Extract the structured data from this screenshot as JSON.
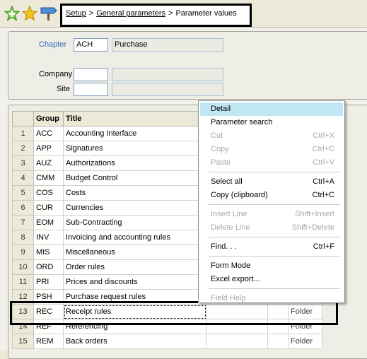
{
  "toolbar": {
    "icons": [
      "add-favorite-icon",
      "favorite-star-icon",
      "sign-icon"
    ]
  },
  "breadcrumb": {
    "items": [
      "Setup",
      "General parameters",
      "Parameter values"
    ],
    "separator": ">"
  },
  "header": {
    "chapter_label": "Chapter",
    "chapter_code": "ACH",
    "chapter_name": "Purchase",
    "company_label": "Company",
    "company_value": "",
    "company_name": "",
    "site_label": "Site",
    "site_value": "",
    "site_name": ""
  },
  "table": {
    "columns": [
      "Group",
      "Title"
    ],
    "rows": [
      {
        "num": "1",
        "group": "ACC",
        "title": "Accounting Interface",
        "extra": ""
      },
      {
        "num": "2",
        "group": "APP",
        "title": "Signatures",
        "extra": ""
      },
      {
        "num": "3",
        "group": "AUZ",
        "title": "Authorizations",
        "extra": ""
      },
      {
        "num": "4",
        "group": "CMM",
        "title": "Budget Control",
        "extra": ""
      },
      {
        "num": "5",
        "group": "COS",
        "title": "Costs",
        "extra": ""
      },
      {
        "num": "6",
        "group": "CUR",
        "title": "Currencies",
        "extra": ""
      },
      {
        "num": "7",
        "group": "EOM",
        "title": "Sub-Contracting",
        "extra": ""
      },
      {
        "num": "8",
        "group": "INV",
        "title": "Invoicing and accounting rules",
        "extra": ""
      },
      {
        "num": "9",
        "group": "MIS",
        "title": "Miscellaneous",
        "extra": ""
      },
      {
        "num": "10",
        "group": "ORD",
        "title": "Order rules",
        "extra": ""
      },
      {
        "num": "11",
        "group": "PRI",
        "title": "Prices and discounts",
        "extra": ""
      },
      {
        "num": "12",
        "group": "PSH",
        "title": "Purchase request rules",
        "extra": ""
      },
      {
        "num": "13",
        "group": "REC",
        "title": "Receipt rules",
        "extra": "Folder"
      },
      {
        "num": "14",
        "group": "REF",
        "title": "Referencing",
        "extra": "Folder"
      },
      {
        "num": "15",
        "group": "REM",
        "title": "Back orders",
        "extra": "Folder"
      }
    ]
  },
  "context_menu": {
    "items": [
      {
        "label": "Detail",
        "shortcut": "",
        "disabled": false,
        "highlighted": true
      },
      {
        "label": "Parameter search",
        "shortcut": "",
        "disabled": false
      },
      {
        "label": "Cut",
        "shortcut": "Ctrl+X",
        "disabled": true
      },
      {
        "label": "Copy",
        "shortcut": "Ctrl+C",
        "disabled": true
      },
      {
        "label": "Paste",
        "shortcut": "Ctrl+V",
        "disabled": true
      },
      {
        "label": "Select all",
        "shortcut": "Ctrl+A",
        "disabled": false
      },
      {
        "label": "Copy (clipboard)",
        "shortcut": "Ctrl+C",
        "disabled": false
      },
      {
        "label": "Insert Line",
        "shortcut": "Shift+Insert",
        "disabled": true
      },
      {
        "label": "Delete Line",
        "shortcut": "Shift+Delete",
        "disabled": true
      },
      {
        "label": "Find. . .",
        "shortcut": "Ctrl+F",
        "disabled": false
      },
      {
        "label": "Form Mode",
        "shortcut": "",
        "disabled": false
      },
      {
        "label": "Excel export...",
        "shortcut": "",
        "disabled": false
      },
      {
        "label": "Field Help",
        "shortcut": "",
        "disabled": true
      }
    ]
  },
  "colors": {
    "link": "#2a6dbd",
    "menu_highlight": "#bfe6f3",
    "background": "#ece9d8"
  }
}
